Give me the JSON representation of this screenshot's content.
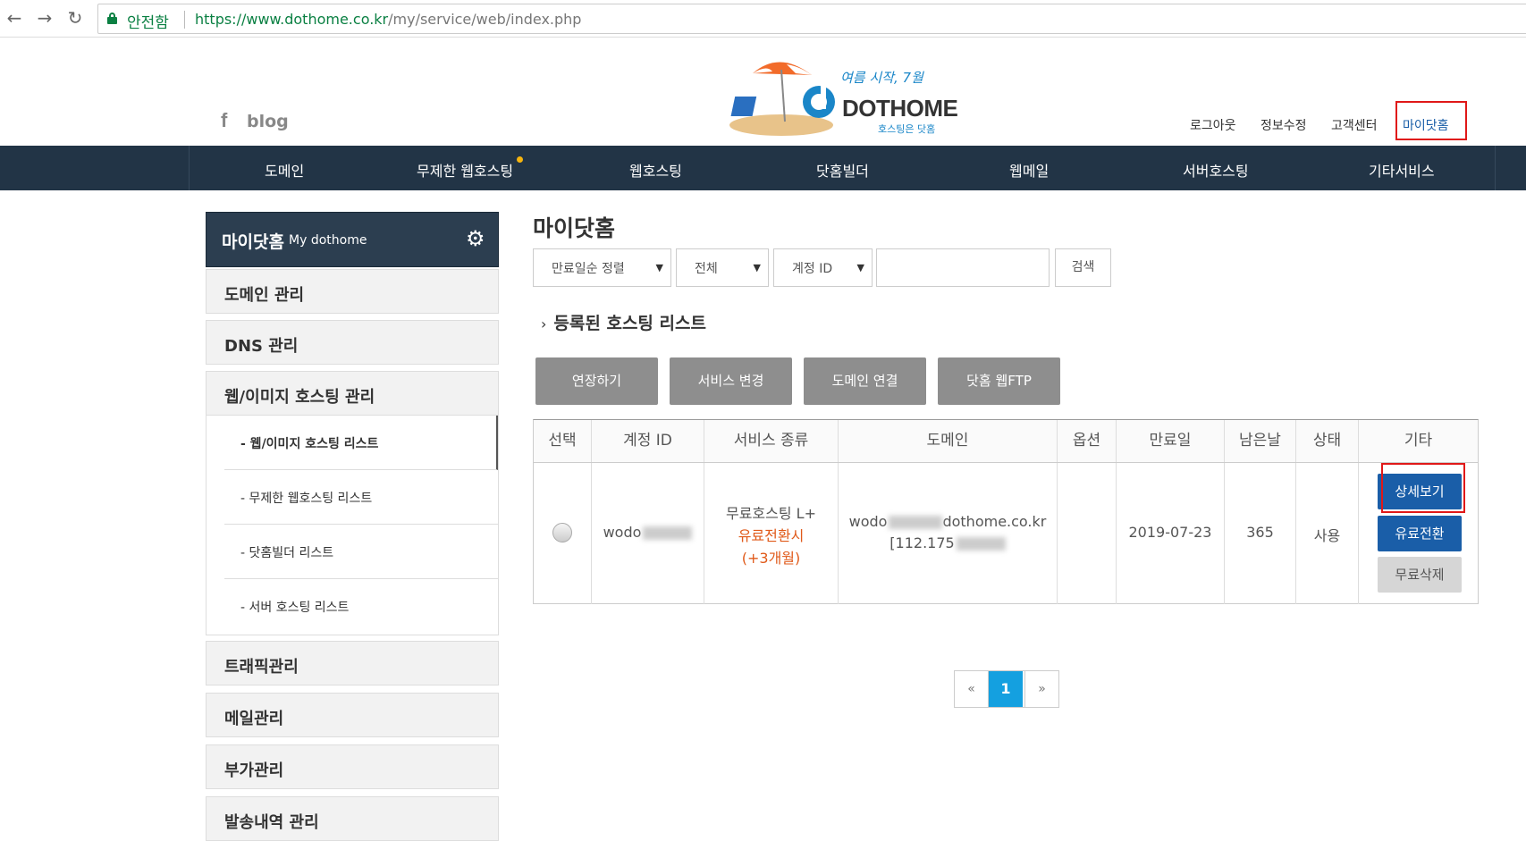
{
  "browser": {
    "secure_label": "안전함",
    "url_host": "https://www.dothome.co.kr",
    "url_path": "/my/service/web/index.php"
  },
  "header": {
    "blog_label": "blog",
    "logo_text": "DOTHOME",
    "logo_slogan": "여름 시작, 7월",
    "logo_sub": "호스팅은 닷홈",
    "top_links": [
      "로그아웃",
      "정보수정",
      "고객센터",
      "마이닷홈"
    ]
  },
  "nav": {
    "items": [
      "도메인",
      "무제한 웹호스팅",
      "웹호스팅",
      "닷홈빌더",
      "웹메일",
      "서버호스팅",
      "기타서비스"
    ]
  },
  "sidebar": {
    "title": "마이닷홈",
    "subtitle": "My dothome",
    "items": [
      "도메인 관리",
      "DNS 관리",
      "웹/이미지 호스팅 관리",
      "트래픽관리",
      "메일관리",
      "부가관리",
      "발송내역 관리"
    ],
    "sub_items": [
      "- 웹/이미지 호스팅 리스트",
      "- 무제한 웹호스팅 리스트",
      "- 닷홈빌더 리스트",
      "- 서버 호스팅 리스트"
    ]
  },
  "main": {
    "title": "마이닷홈",
    "filters": {
      "sort": "만료일순 정렬",
      "type": "전체",
      "field": "계정 ID",
      "search_value": "",
      "search_button": "검색"
    },
    "section_title": "등록된 호스팅 리스트",
    "actions": [
      "연장하기",
      "서비스 변경",
      "도메인 연결",
      "닷홈 웹FTP"
    ],
    "table": {
      "headers": [
        "선택",
        "계정 ID",
        "서비스 종류",
        "도메인",
        "옵션",
        "만료일",
        "남은날",
        "상태",
        "기타"
      ],
      "row": {
        "account_id": "wodo",
        "service_line1": "무료호스팅 L+",
        "service_line2": "유료전환시",
        "service_line3": "(+3개월)",
        "domain_line1_a": "wodo",
        "domain_line1_b": "dothome.co.kr",
        "domain_line2": "[112.175",
        "option": "",
        "expiry": "2019-07-23",
        "days_left": "365",
        "status": "사용",
        "buttons": [
          "상세보기",
          "유료전환",
          "무료삭제"
        ]
      }
    },
    "pagination": {
      "prev": "«",
      "current": "1",
      "next": "»"
    }
  },
  "colors": {
    "nav_bg": "#223446",
    "accent_blue": "#1a5ea8",
    "highlight_red": "#e01818",
    "pager_current": "#14a0e0"
  }
}
